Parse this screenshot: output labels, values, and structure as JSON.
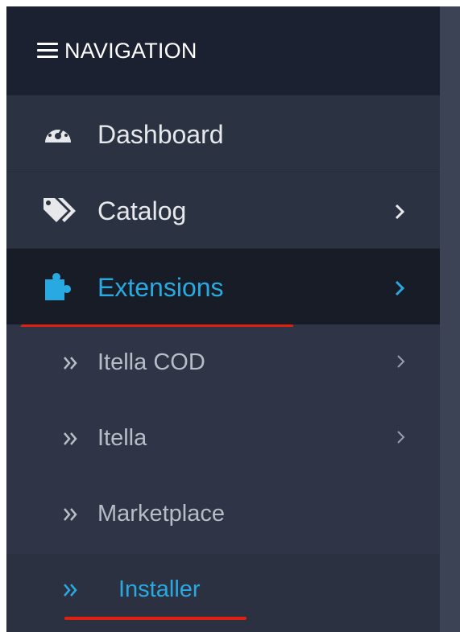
{
  "navigation": {
    "header_title": "NAVIGATION"
  },
  "menu": {
    "dashboard": {
      "label": "Dashboard"
    },
    "catalog": {
      "label": "Catalog"
    },
    "extensions": {
      "label": "Extensions"
    }
  },
  "submenu": {
    "itella_cod": {
      "label": "Itella COD"
    },
    "itella": {
      "label": "Itella"
    },
    "marketplace": {
      "label": "Marketplace"
    },
    "installer": {
      "label": "Installer"
    }
  },
  "icons": {
    "header": "hamburger-icon",
    "dashboard": "dashboard-gauge-icon",
    "catalog": "tags-icon",
    "extensions": "puzzle-icon",
    "submenu_bullet": "double-chevron-right-icon",
    "expand": "chevron-right-icon"
  },
  "colors": {
    "accent": "#29a9e1",
    "annotation": "#e0200f",
    "header_bg": "#1c2131",
    "active_bg": "#171c26"
  }
}
